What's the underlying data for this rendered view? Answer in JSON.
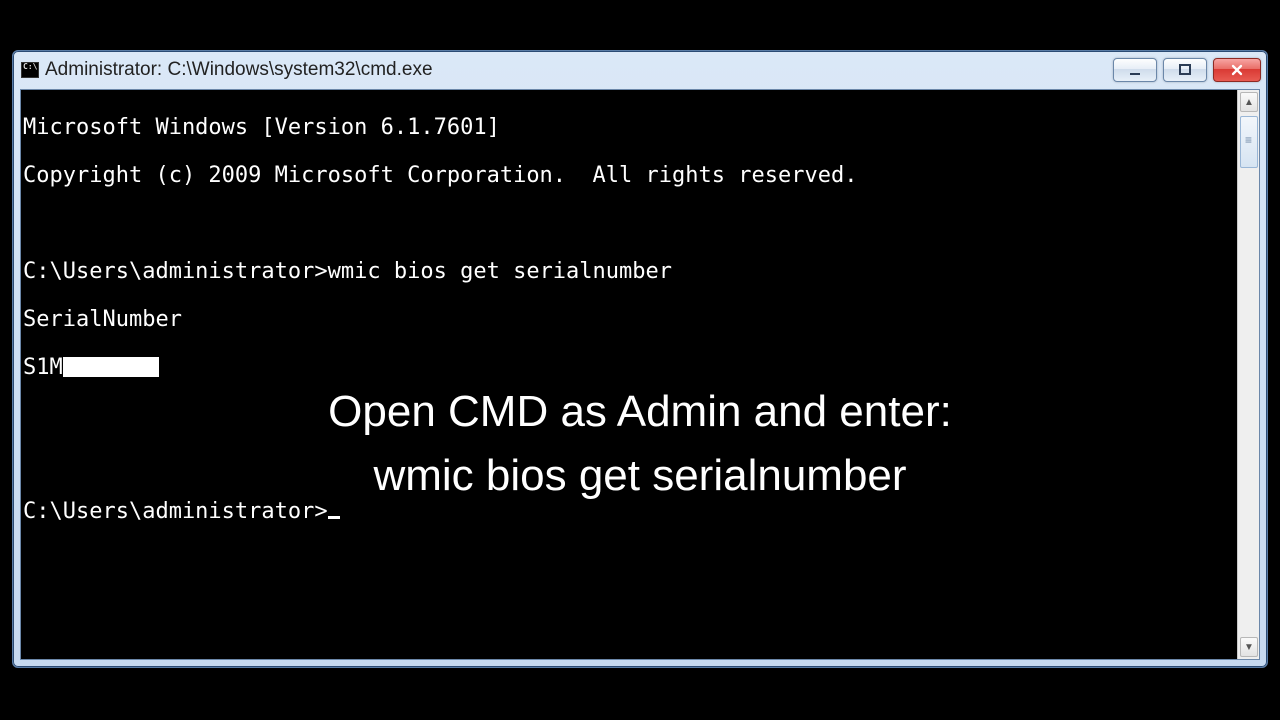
{
  "window": {
    "title": "Administrator: C:\\Windows\\system32\\cmd.exe"
  },
  "console": {
    "banner_version": "Microsoft Windows [Version 6.1.7601]",
    "banner_copyright": "Copyright (c) 2009 Microsoft Corporation.  All rights reserved.",
    "prompt1": "C:\\Users\\administrator>",
    "command1": "wmic bios get serialnumber",
    "output_header": "SerialNumber",
    "output_serial_visible": "S1M",
    "prompt2": "C:\\Users\\administrator>"
  },
  "overlay": {
    "line1": "Open CMD as Admin and enter:",
    "line2": "wmic bios get serialnumber"
  }
}
